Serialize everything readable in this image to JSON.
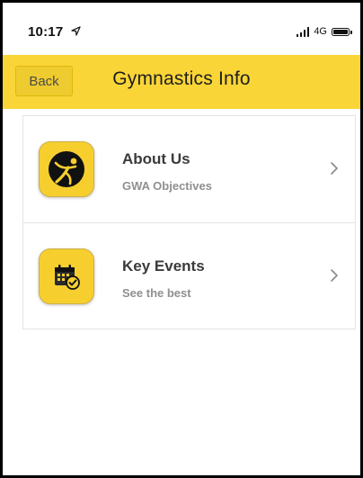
{
  "status_bar": {
    "time": "10:17",
    "network": "4G",
    "location_icon": "location-arrow-icon",
    "signal_icon": "signal-bars-icon",
    "battery_icon": "battery-icon"
  },
  "navbar": {
    "back_label": "Back",
    "title": "Gymnastics Info",
    "background_color": "#f9d537"
  },
  "list": {
    "items": [
      {
        "title": "About Us",
        "subtitle": "GWA Objectives",
        "icon": "gymnast-icon"
      },
      {
        "title": "Key Events",
        "subtitle": "See the best",
        "icon": "calendar-check-icon"
      }
    ]
  }
}
